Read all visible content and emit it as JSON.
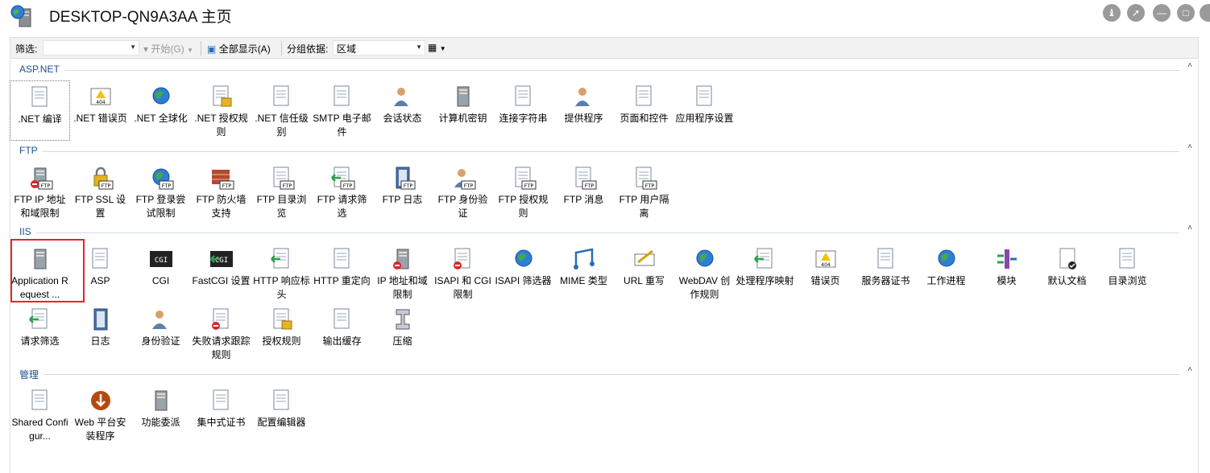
{
  "window": {
    "title": "DESKTOP-QN9A3AA 主页"
  },
  "toolbar": {
    "filter_label": "筛选:",
    "filter_value": "",
    "start_label": "开始(G)",
    "show_all_label": "全部显示(A)",
    "group_by_label": "分组依据:",
    "group_by_value": "区域"
  },
  "groups": [
    {
      "title": "ASP.NET",
      "items": [
        {
          "label": ".NET 编译",
          "icon": "dotnet-compile-icon"
        },
        {
          "label": ".NET 错误页",
          "icon": "error-page-404-icon"
        },
        {
          "label": ".NET 全球化",
          "icon": "globe-icon"
        },
        {
          "label": ".NET 授权规则",
          "icon": "authorization-rules-icon"
        },
        {
          "label": ".NET 信任级别",
          "icon": "trust-level-icon"
        },
        {
          "label": "SMTP 电子邮件",
          "icon": "smtp-email-icon"
        },
        {
          "label": "会话状态",
          "icon": "session-state-icon"
        },
        {
          "label": "计算机密钥",
          "icon": "machine-key-icon"
        },
        {
          "label": "连接字符串",
          "icon": "connection-string-icon"
        },
        {
          "label": "提供程序",
          "icon": "providers-icon"
        },
        {
          "label": "页面和控件",
          "icon": "pages-controls-icon"
        },
        {
          "label": "应用程序设置",
          "icon": "app-settings-icon"
        }
      ]
    },
    {
      "title": "FTP",
      "items": [
        {
          "label": "FTP IP 地址和域限制",
          "icon": "ftp-ip-restrictions-icon"
        },
        {
          "label": "FTP SSL 设置",
          "icon": "ftp-ssl-icon"
        },
        {
          "label": "FTP 登录尝试限制",
          "icon": "ftp-logon-attempts-icon"
        },
        {
          "label": "FTP 防火墙支持",
          "icon": "ftp-firewall-icon"
        },
        {
          "label": "FTP 目录浏览",
          "icon": "ftp-directory-browsing-icon"
        },
        {
          "label": "FTP 请求筛选",
          "icon": "ftp-request-filtering-icon"
        },
        {
          "label": "FTP 日志",
          "icon": "ftp-logging-icon"
        },
        {
          "label": "FTP 身份验证",
          "icon": "ftp-authentication-icon"
        },
        {
          "label": "FTP 授权规则",
          "icon": "ftp-authorization-icon"
        },
        {
          "label": "FTP 消息",
          "icon": "ftp-messages-icon"
        },
        {
          "label": "FTP 用户隔离",
          "icon": "ftp-user-isolation-icon"
        }
      ]
    },
    {
      "title": "IIS",
      "items": [
        {
          "label": "Application Request ...",
          "icon": "application-request-routing-icon"
        },
        {
          "label": "ASP",
          "icon": "asp-icon"
        },
        {
          "label": "CGI",
          "icon": "cgi-icon"
        },
        {
          "label": "FastCGI 设置",
          "icon": "fastcgi-icon"
        },
        {
          "label": "HTTP 响应标头",
          "icon": "http-response-headers-icon"
        },
        {
          "label": "HTTP 重定向",
          "icon": "http-redirect-icon"
        },
        {
          "label": "IP 地址和域限制",
          "icon": "ip-restrictions-icon"
        },
        {
          "label": "ISAPI 和 CGI 限制",
          "icon": "isapi-cgi-restrictions-icon"
        },
        {
          "label": "ISAPI 筛选器",
          "icon": "isapi-filters-icon"
        },
        {
          "label": "MIME 类型",
          "icon": "mime-types-icon"
        },
        {
          "label": "URL 重写",
          "icon": "url-rewrite-icon"
        },
        {
          "label": "WebDAV 创作规则",
          "icon": "webdav-icon"
        },
        {
          "label": "处理程序映射",
          "icon": "handler-mappings-icon"
        },
        {
          "label": "错误页",
          "icon": "error-pages-icon"
        },
        {
          "label": "服务器证书",
          "icon": "server-certificates-icon"
        },
        {
          "label": "工作进程",
          "icon": "worker-processes-icon"
        },
        {
          "label": "模块",
          "icon": "modules-icon"
        },
        {
          "label": "默认文档",
          "icon": "default-document-icon"
        },
        {
          "label": "目录浏览",
          "icon": "directory-browsing-icon"
        },
        {
          "label": "请求筛选",
          "icon": "request-filtering-icon"
        },
        {
          "label": "日志",
          "icon": "logging-icon"
        },
        {
          "label": "身份验证",
          "icon": "authentication-icon"
        },
        {
          "label": "失败请求跟踪规则",
          "icon": "failed-request-tracing-icon"
        },
        {
          "label": "授权规则",
          "icon": "authorization-icon"
        },
        {
          "label": "输出缓存",
          "icon": "output-caching-icon"
        },
        {
          "label": "压缩",
          "icon": "compression-icon"
        }
      ]
    },
    {
      "title": "管理",
      "items": [
        {
          "label": "Shared Configur...",
          "icon": "shared-configuration-icon"
        },
        {
          "label": "Web 平台安装程序",
          "icon": "web-platform-installer-icon"
        },
        {
          "label": "功能委派",
          "icon": "feature-delegation-icon"
        },
        {
          "label": "集中式证书",
          "icon": "centralized-certificates-icon"
        },
        {
          "label": "配置编辑器",
          "icon": "configuration-editor-icon"
        }
      ]
    }
  ]
}
